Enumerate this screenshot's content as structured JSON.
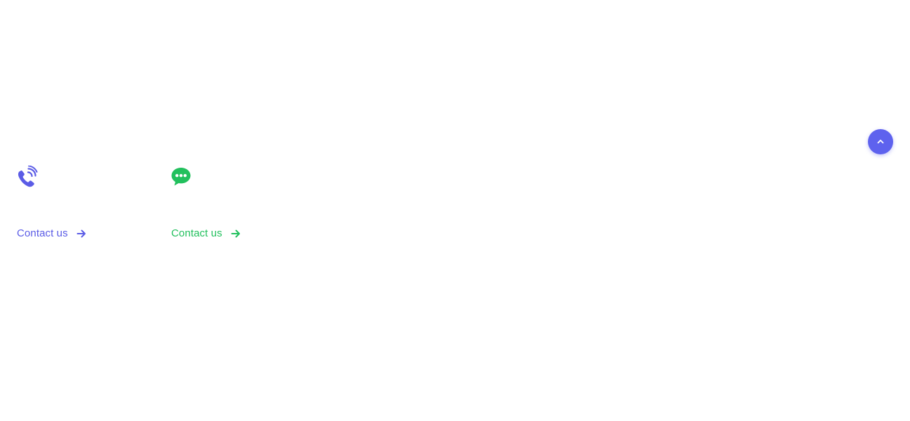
{
  "colors": {
    "phone_accent": "#5b5ce6",
    "chat_accent": "#22c05d",
    "back_to_top_bg": "#5e62ee"
  },
  "cards": [
    {
      "icon": "phone-ringing-icon",
      "link_label": "Contact us",
      "link_icon": "arrow-right-icon"
    },
    {
      "icon": "chat-bubble-icon",
      "link_label": "Contact us",
      "link_icon": "arrow-right-icon"
    }
  ],
  "back_to_top": {
    "icon": "chevron-up-icon"
  }
}
